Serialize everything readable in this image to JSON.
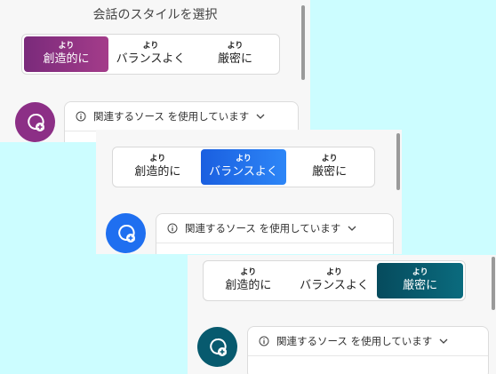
{
  "title": "会話のスタイルを選択",
  "styles": [
    {
      "small": "より",
      "label": "創造的に"
    },
    {
      "small": "より",
      "label": "バランスよく"
    },
    {
      "small": "より",
      "label": "厳密に"
    }
  ],
  "sources_text": "関連するソース を使用しています",
  "icons": {
    "info": "info-icon",
    "chevron": "chevron-down-icon",
    "avatar": "chat-plus-icon"
  },
  "colors": {
    "background": "#ccfdff",
    "creative": "#8c2f86",
    "balanced": "#1f6ff0",
    "precise": "#075a6e"
  }
}
